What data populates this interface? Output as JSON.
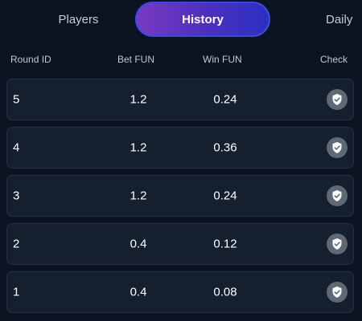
{
  "tabs": [
    {
      "label": "Players",
      "active": false
    },
    {
      "label": "History",
      "active": true
    },
    {
      "label": "Daily",
      "active": false
    }
  ],
  "table": {
    "headers": {
      "round_id": "Round ID",
      "bet": "Bet  FUN",
      "win": "Win  FUN",
      "check": "Check"
    },
    "rows": [
      {
        "round_id": "5",
        "bet": "1.2",
        "win": "0.24",
        "check_icon": "shield-check-icon"
      },
      {
        "round_id": "4",
        "bet": "1.2",
        "win": "0.36",
        "check_icon": "shield-check-icon"
      },
      {
        "round_id": "3",
        "bet": "1.2",
        "win": "0.24",
        "check_icon": "shield-check-icon"
      },
      {
        "round_id": "2",
        "bet": "0.4",
        "win": "0.12",
        "check_icon": "shield-check-icon"
      },
      {
        "round_id": "1",
        "bet": "0.4",
        "win": "0.08",
        "check_icon": "shield-check-icon"
      }
    ]
  },
  "colors": {
    "background": "#0b1220",
    "row_background": "#15202e",
    "active_tab_gradient_start": "#7a3ac0",
    "active_tab_gradient_end": "#2d2fc5"
  }
}
